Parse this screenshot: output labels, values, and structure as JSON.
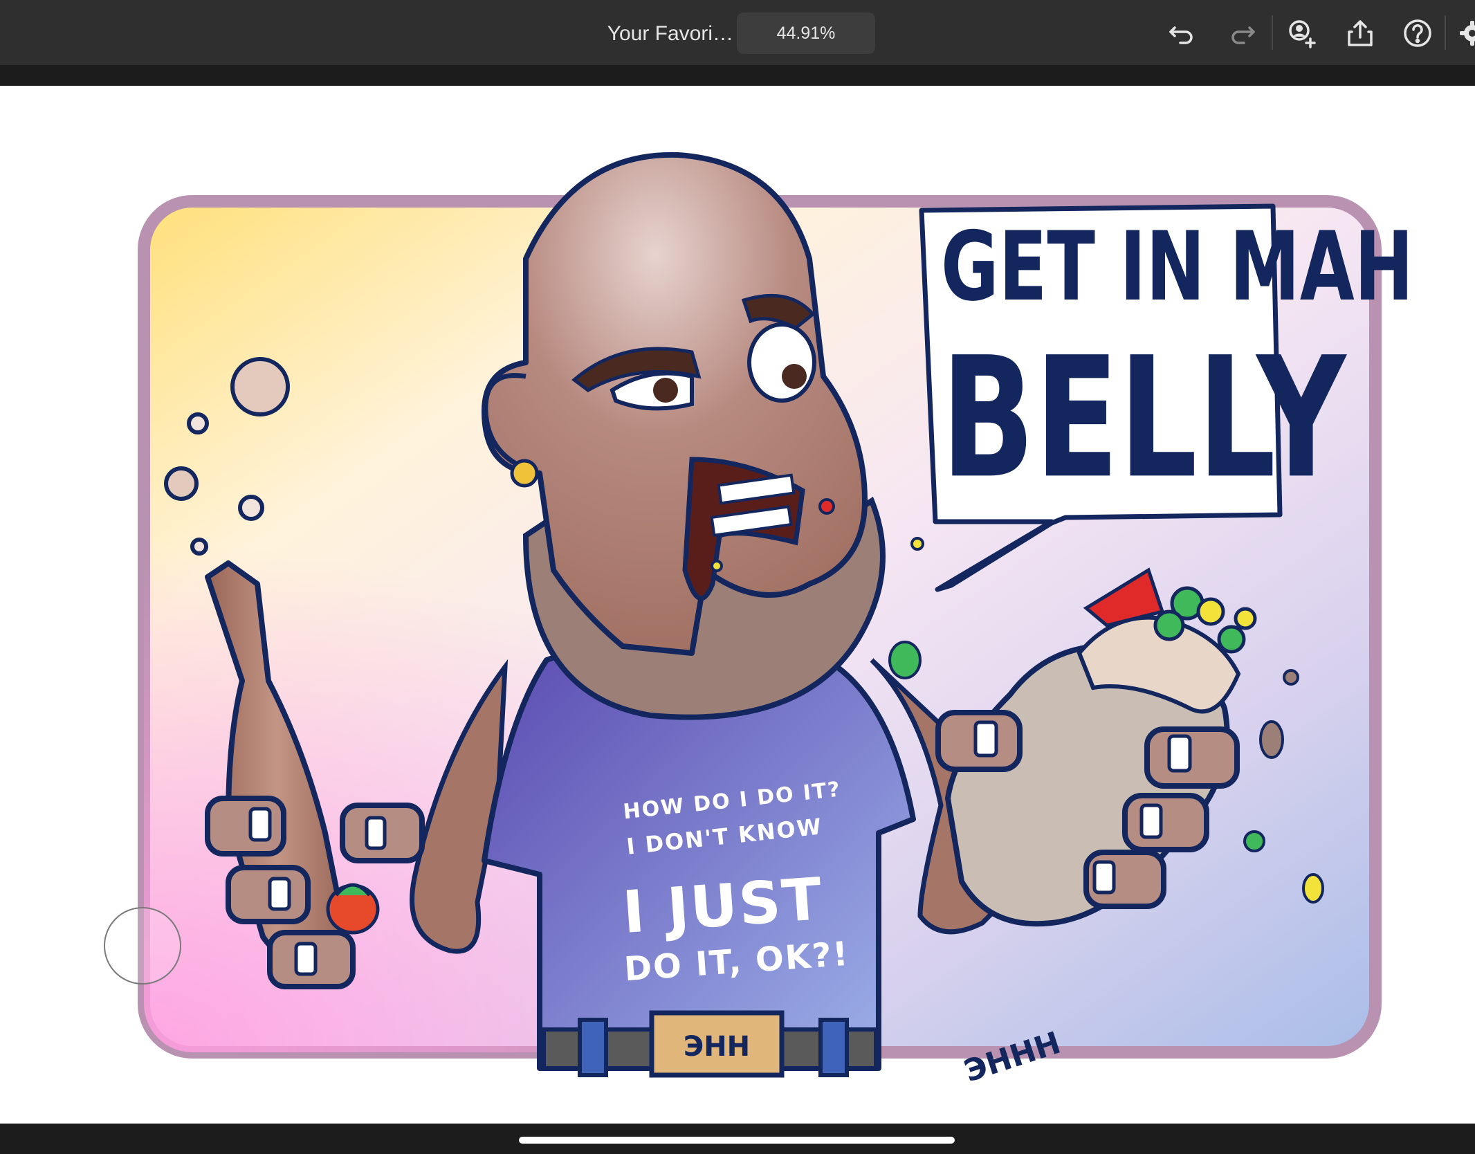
{
  "app": {
    "document_title": "Your Favori…",
    "zoom_level": "44.91%"
  },
  "toolbar": {
    "icons": [
      "undo-icon",
      "redo-icon",
      "add-user-icon",
      "share-icon",
      "help-icon",
      "settings-icon"
    ]
  },
  "artwork": {
    "speech_bubble": {
      "line1": "GET IN MAH",
      "line2": "BELLY"
    },
    "shirt": {
      "line1": "HOW DO I DO IT?",
      "line2": "I DON'T KNOW",
      "line3": "I JUST",
      "line4": "DO IT, OK?!"
    },
    "signature_text": "Ǝħħħ"
  },
  "colors": {
    "toolbar_bg": "#2f2f2f",
    "outline": "#13275e",
    "frame": "#b892b0",
    "skin": "#a57568",
    "shirt": "#6a5fb0",
    "bubble_text": "#13275e"
  }
}
